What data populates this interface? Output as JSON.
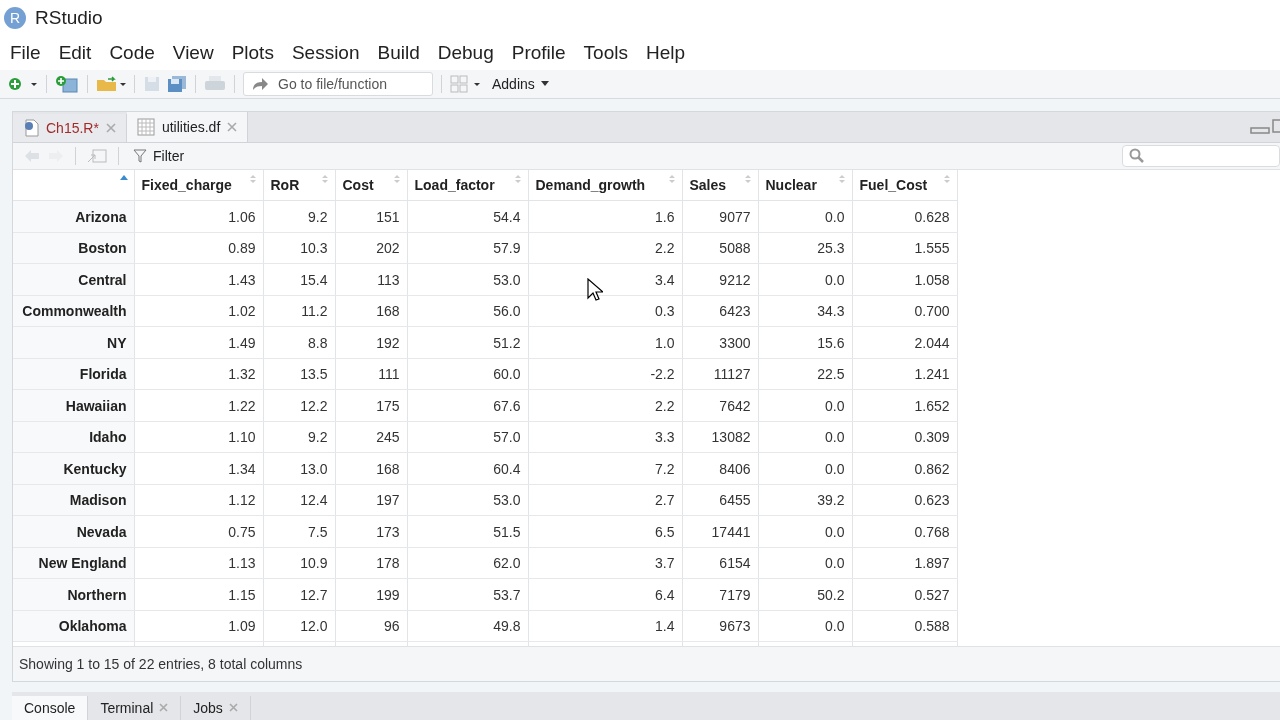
{
  "window": {
    "logo": "R",
    "title": "RStudio"
  },
  "menu": [
    "File",
    "Edit",
    "Code",
    "View",
    "Plots",
    "Session",
    "Build",
    "Debug",
    "Profile",
    "Tools",
    "Help"
  ],
  "toolbar": {
    "goto_placeholder": "Go to file/function",
    "addins": "Addins"
  },
  "editor_tabs": [
    {
      "label": "Ch15.R*",
      "kind": "script",
      "modified": true,
      "selected": false
    },
    {
      "label": "utilities.df",
      "kind": "data",
      "modified": false,
      "selected": true
    }
  ],
  "viewer": {
    "filter": "Filter",
    "columns": [
      {
        "sorted": true
      },
      {
        "label": "Fixed_charge",
        "sorted": false
      },
      {
        "label": "RoR",
        "sorted": false
      },
      {
        "label": "Cost",
        "sorted": false
      },
      {
        "label": "Load_factor",
        "sorted": false
      },
      {
        "label": "Demand_growth",
        "sorted": false
      },
      {
        "label": "Sales",
        "sorted": false
      },
      {
        "label": "Nuclear",
        "sorted": false
      },
      {
        "label": "Fuel_Cost",
        "sorted": false
      }
    ],
    "rows": [
      [
        "Arizona",
        "1.06",
        "9.2",
        "151",
        "54.4",
        "1.6",
        "9077",
        "0.0",
        "0.628"
      ],
      [
        "Boston",
        "0.89",
        "10.3",
        "202",
        "57.9",
        "2.2",
        "5088",
        "25.3",
        "1.555"
      ],
      [
        "Central",
        "1.43",
        "15.4",
        "113",
        "53.0",
        "3.4",
        "9212",
        "0.0",
        "1.058"
      ],
      [
        "Commonwealth",
        "1.02",
        "11.2",
        "168",
        "56.0",
        "0.3",
        "6423",
        "34.3",
        "0.700"
      ],
      [
        "NY",
        "1.49",
        "8.8",
        "192",
        "51.2",
        "1.0",
        "3300",
        "15.6",
        "2.044"
      ],
      [
        "Florida",
        "1.32",
        "13.5",
        "111",
        "60.0",
        "-2.2",
        "11127",
        "22.5",
        "1.241"
      ],
      [
        "Hawaiian",
        "1.22",
        "12.2",
        "175",
        "67.6",
        "2.2",
        "7642",
        "0.0",
        "1.652"
      ],
      [
        "Idaho",
        "1.10",
        "9.2",
        "245",
        "57.0",
        "3.3",
        "13082",
        "0.0",
        "0.309"
      ],
      [
        "Kentucky",
        "1.34",
        "13.0",
        "168",
        "60.4",
        "7.2",
        "8406",
        "0.0",
        "0.862"
      ],
      [
        "Madison",
        "1.12",
        "12.4",
        "197",
        "53.0",
        "2.7",
        "6455",
        "39.2",
        "0.623"
      ],
      [
        "Nevada",
        "0.75",
        "7.5",
        "173",
        "51.5",
        "6.5",
        "17441",
        "0.0",
        "0.768"
      ],
      [
        "New England",
        "1.13",
        "10.9",
        "178",
        "62.0",
        "3.7",
        "6154",
        "0.0",
        "1.897"
      ],
      [
        "Northern",
        "1.15",
        "12.7",
        "199",
        "53.7",
        "6.4",
        "7179",
        "50.2",
        "0.527"
      ],
      [
        "Oklahoma",
        "1.09",
        "12.0",
        "96",
        "49.8",
        "1.4",
        "9673",
        "0.0",
        "0.588"
      ]
    ],
    "status": "Showing 1 to 15 of 22 entries, 8 total columns"
  },
  "bottom_tabs": [
    {
      "label": "Console",
      "closable": false,
      "selected": true
    },
    {
      "label": "Terminal",
      "closable": true,
      "selected": false
    },
    {
      "label": "Jobs",
      "closable": true,
      "selected": false
    }
  ]
}
